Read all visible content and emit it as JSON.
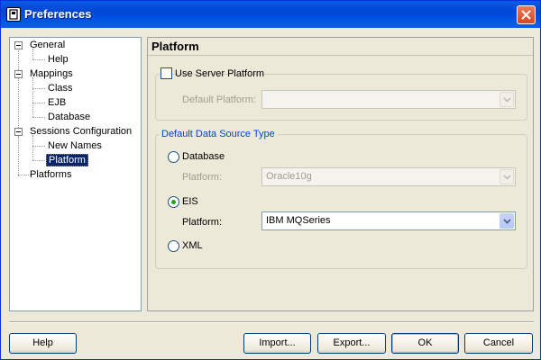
{
  "window": {
    "title": "Preferences",
    "icon": "app-icon",
    "close_icon": "close-icon"
  },
  "tree": {
    "items": [
      {
        "label": "General",
        "expanded": true
      },
      {
        "label": "Help"
      },
      {
        "label": "Mappings",
        "expanded": true
      },
      {
        "label": "Class"
      },
      {
        "label": "EJB"
      },
      {
        "label": "Database"
      },
      {
        "label": "Sessions Configuration",
        "expanded": true
      },
      {
        "label": "New Names"
      },
      {
        "label": "Platform",
        "selected": true
      },
      {
        "label": "Platforms"
      }
    ]
  },
  "panel": {
    "title": "Platform",
    "server_platform": {
      "checkbox_label": "Use Server Platform",
      "checked": false,
      "default_platform_label": "Default Platform:",
      "default_platform_value": ""
    },
    "data_source": {
      "legend": "Default Data Source Type",
      "database_label": "Database",
      "database_platform_label": "Platform:",
      "database_platform_value": "Oracle10g",
      "eis_label": "EIS",
      "eis_platform_label": "Platform:",
      "eis_platform_value": "IBM MQSeries",
      "xml_label": "XML",
      "selected": "EIS"
    }
  },
  "buttons": {
    "help": "Help",
    "import": "Import...",
    "export": "Export...",
    "ok": "OK",
    "cancel": "Cancel"
  },
  "colors": {
    "titlebar": "#0054e3",
    "accent": "#0046d5",
    "selection": "#0a246a"
  }
}
